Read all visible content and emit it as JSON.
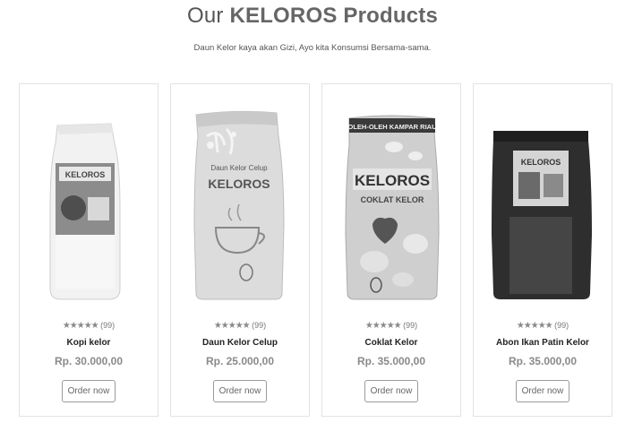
{
  "header": {
    "title_prefix": "Our",
    "title_brand": "KELOROS Products",
    "subtitle": "Daun Kelor kaya akan Gizi, Ayo kita Konsumsi Bersama-sama."
  },
  "products": [
    {
      "name": "Kopi kelor",
      "price": "Rp. 30.000,00",
      "stars": "★★★★★",
      "reviews": "(99)",
      "button": "Order now",
      "image_label": "KELOROS"
    },
    {
      "name": "Daun Kelor Celup",
      "price": "Rp. 25.000,00",
      "stars": "★★★★★",
      "reviews": "(99)",
      "button": "Order now",
      "image_label": "KELOROS",
      "image_caption": "Daun Kelor Celup"
    },
    {
      "name": "Coklat Kelor",
      "price": "Rp. 35.000,00",
      "stars": "★★★★★",
      "reviews": "(99)",
      "button": "Order now",
      "image_label": "KELOROS",
      "image_banner": "OLEH-OLEH KAMPAR RIAU",
      "image_caption": "COKLAT KELOR"
    },
    {
      "name": "Abon Ikan Patin Kelor",
      "price": "Rp. 35.000,00",
      "stars": "★★★★★",
      "reviews": "(99)",
      "button": "Order now",
      "image_label": "KELOROS"
    }
  ]
}
